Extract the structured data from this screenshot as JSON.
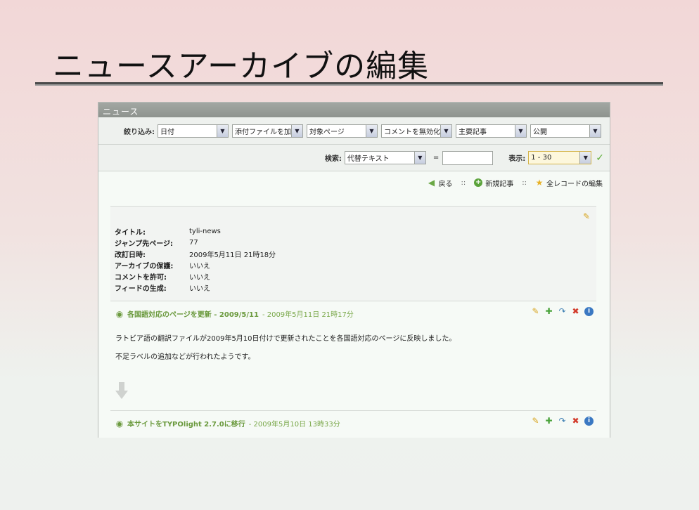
{
  "slide": {
    "title": "ニュースアーカイブの編集"
  },
  "window": {
    "title": "ニュース"
  },
  "filter": {
    "label": "絞り込み:",
    "selects": [
      {
        "value": "日付"
      },
      {
        "value": "添付ファイルを加"
      },
      {
        "value": "対象ページ"
      },
      {
        "value": "コメントを無効化"
      },
      {
        "value": "主要記事"
      },
      {
        "value": "公開"
      }
    ]
  },
  "search": {
    "label": "検索:",
    "field_value": "代替テキスト",
    "equals": "=",
    "text_value": "",
    "show_label": "表示:",
    "show_value": "1 - 30"
  },
  "actions": {
    "back": "戻る",
    "sep": "::",
    "new": "新規記事",
    "edit_all": "全レコードの編集"
  },
  "archive": {
    "rows": [
      {
        "key": "タイトル:",
        "value": "tyli-news"
      },
      {
        "key": "ジャンプ先ページ:",
        "value": "77"
      },
      {
        "key": "改訂日時:",
        "value": "2009年5月11日 21時18分"
      },
      {
        "key": "アーカイブの保護:",
        "value": "いいえ"
      },
      {
        "key": "コメントを許可:",
        "value": "いいえ"
      },
      {
        "key": "フィードの生成:",
        "value": "いいえ"
      }
    ]
  },
  "items": [
    {
      "title": "各国語対応のページを更新 - 2009/5/11",
      "date": "- 2009年5月11日 21時17分",
      "paragraphs": [
        "ラトビア語の翻訳ファイルが2009年5月10日付けで更新されたことを各国語対応のページに反映しました。",
        "不足ラベルの追加などが行われたようです。"
      ]
    },
    {
      "title": "本サイトをTYPOlight 2.7.0に移行",
      "date": "- 2009年5月10日 13時33分"
    }
  ],
  "colors": {
    "accent_green": "#6b9a3e",
    "highlight_field": "#fdf7dc"
  }
}
